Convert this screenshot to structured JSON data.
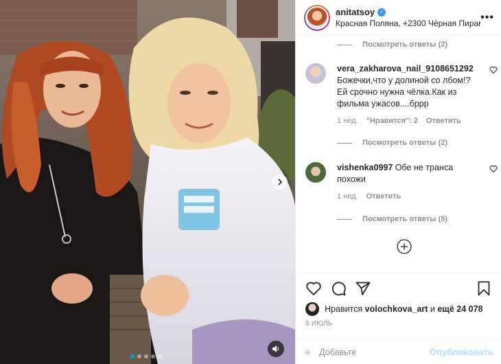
{
  "post": {
    "username": "anitatsoy",
    "location": "Красная Поляна, +2300 Чёрная Пирамида",
    "more_label": "•••"
  },
  "icons": {
    "next": "chevron-right-icon",
    "sound": "speaker-icon",
    "verified": "verified-badge-icon",
    "heart": "heart-icon",
    "comment": "comment-icon",
    "share": "paper-plane-icon",
    "bookmark": "bookmark-icon",
    "emoji": "smiley-icon",
    "load_more": "plus-circle-icon"
  },
  "comments": {
    "replies_top": "Посмотреть ответы (2)",
    "items": [
      {
        "user": "vera_zakharova_nail_9108651292",
        "text": "Божечки,что у долиной со лбом!? Ей срочно нужна чёлка.Как из фильма ужасов....бррр",
        "time": "1 нед.",
        "likes": "\"Нравится\": 2",
        "reply": "Ответить",
        "replies": "Посмотреть ответы (2)"
      },
      {
        "user": "vishenka0997",
        "text": "Обе не транса похожи",
        "time": "1 нед.",
        "reply": "Ответить",
        "replies": "Посмотреть ответы (5)"
      }
    ]
  },
  "likes": {
    "prefix": "Нравится",
    "user": "volochkova_art",
    "conj": "и",
    "more": "ещё 24 078"
  },
  "date": "9 июль",
  "add_comment": {
    "placeholder": "Добавьте",
    "post_label": "Опубликовать"
  },
  "colors": {
    "accent": "#0095f6",
    "muted": "#8e8e8e",
    "text": "#262626",
    "post_disabled": "#b2dffc"
  },
  "carousel": {
    "slides": 5,
    "active_index": 0
  }
}
